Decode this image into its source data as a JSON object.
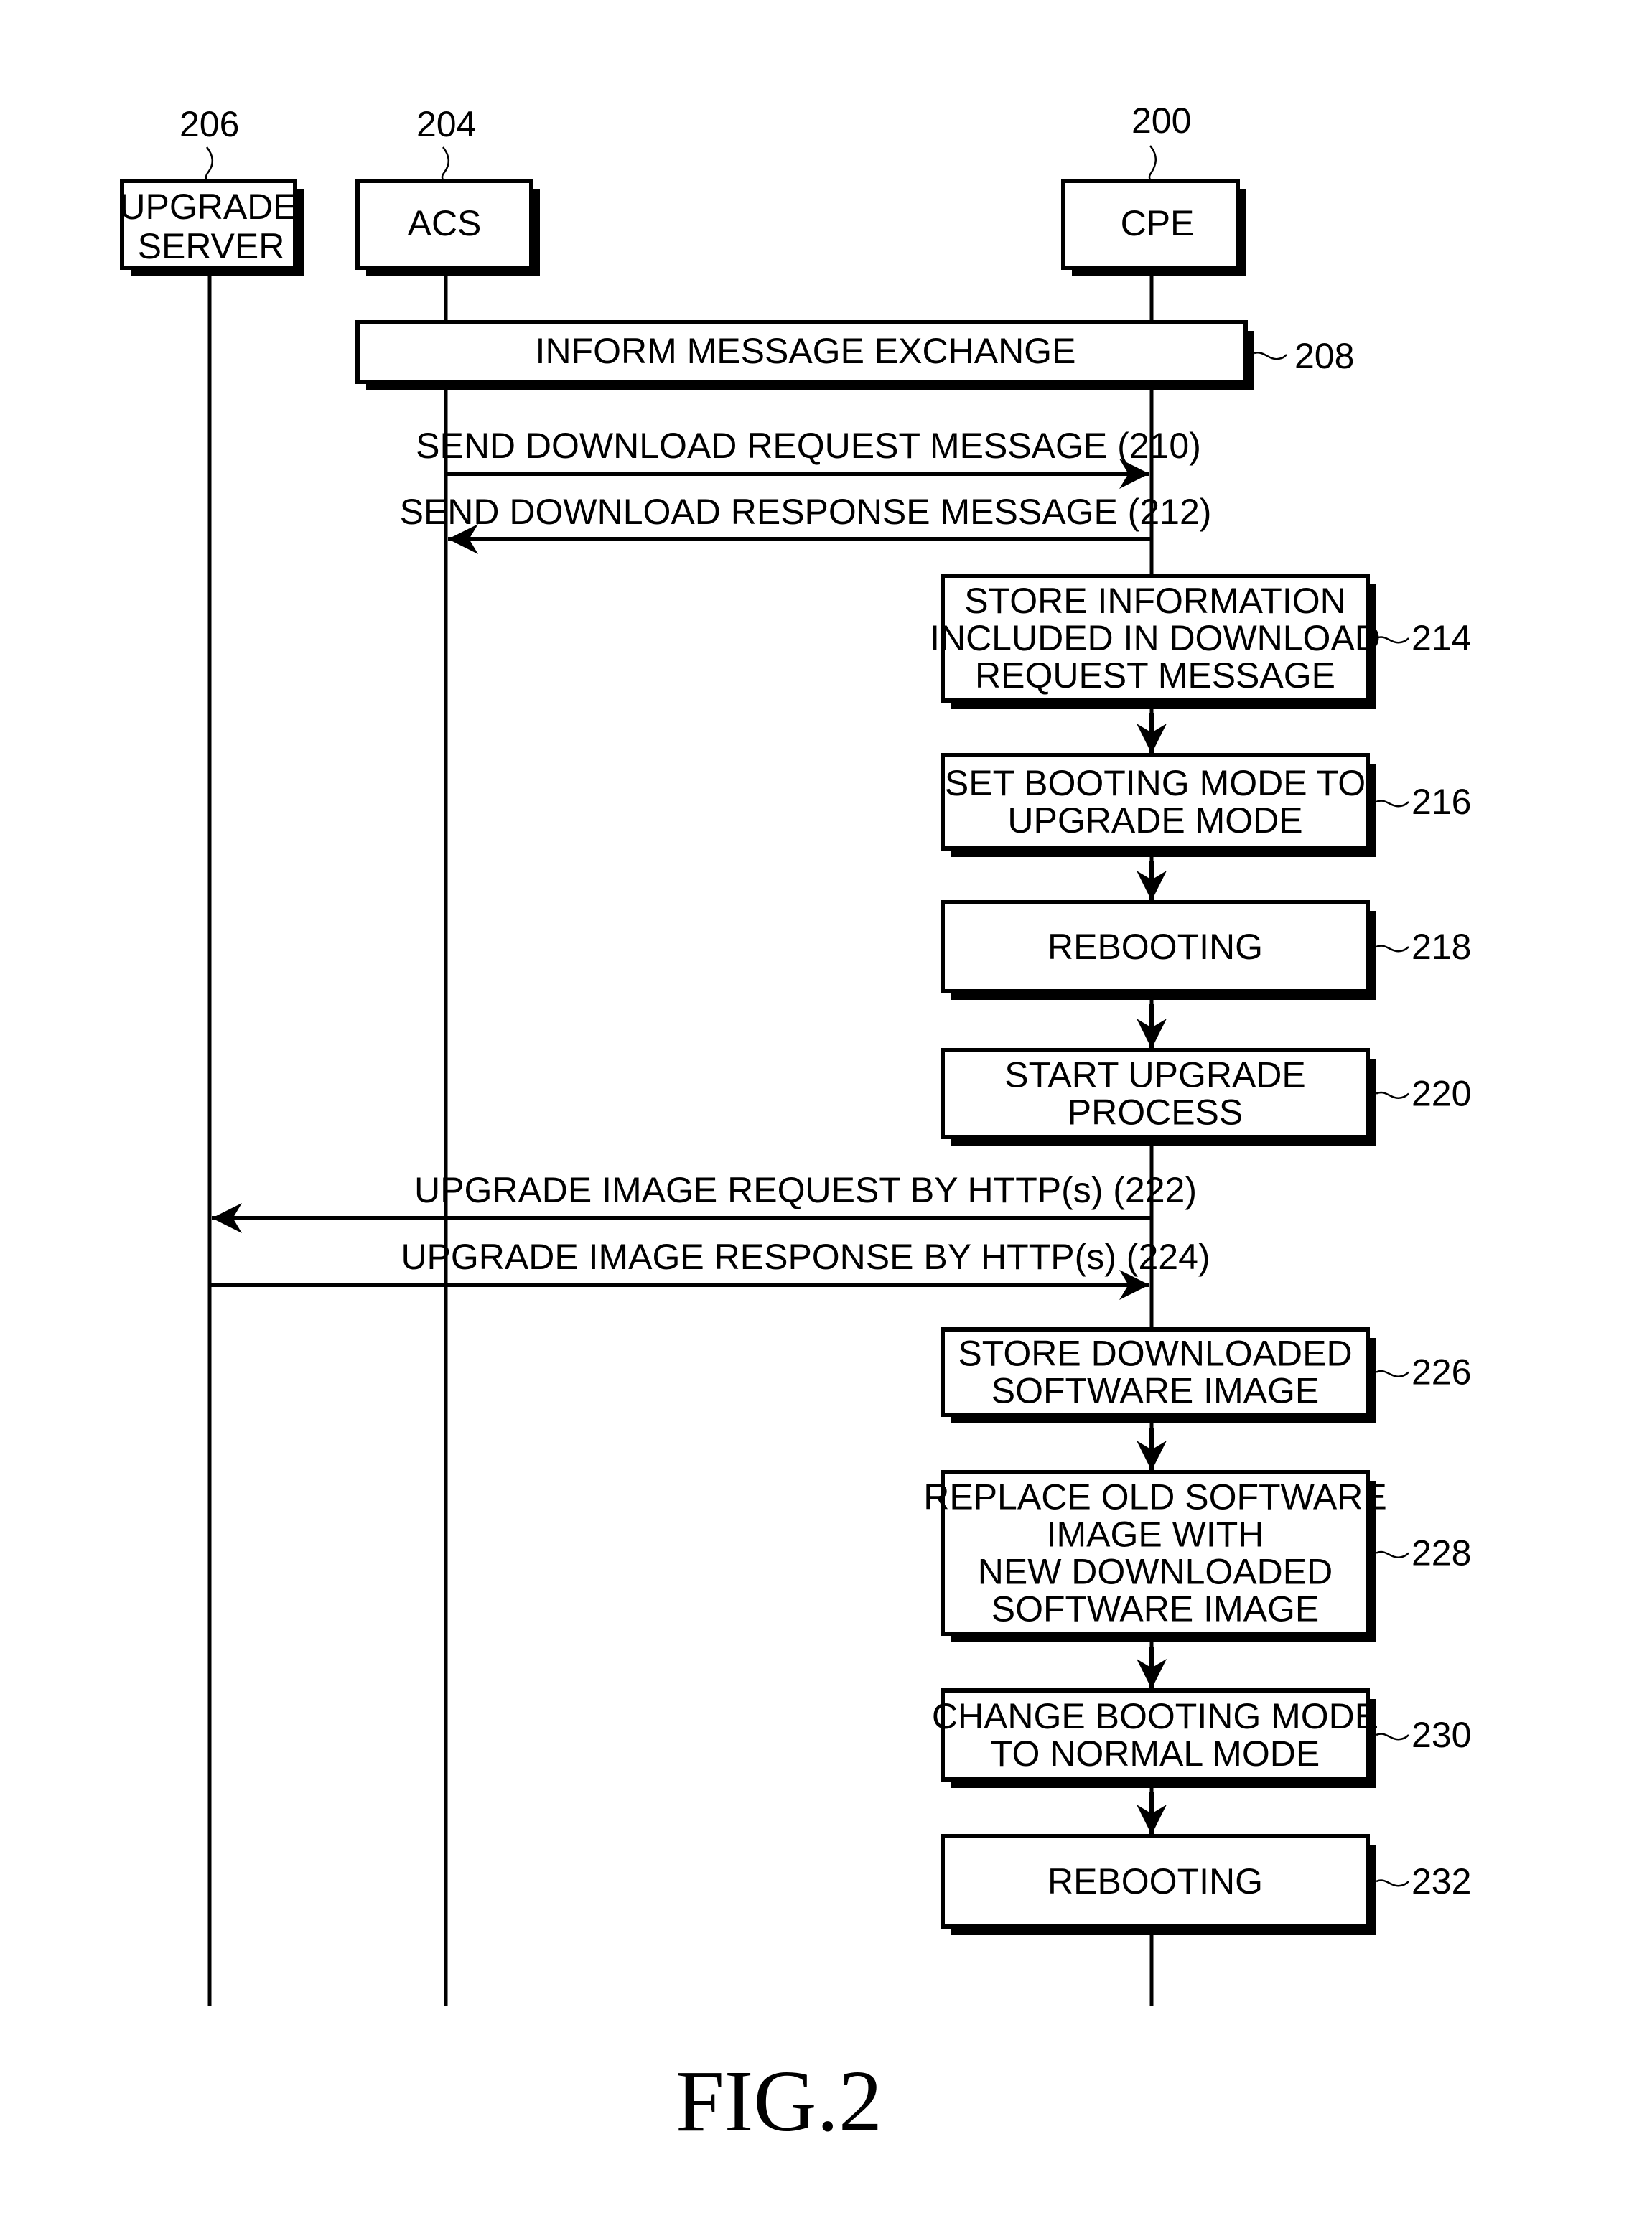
{
  "figure_label": "FIG.2",
  "entities": [
    {
      "ref": "206",
      "lines": [
        "UPGRADE",
        "SERVER"
      ]
    },
    {
      "ref": "204",
      "lines": [
        "ACS"
      ]
    },
    {
      "ref": "200",
      "lines": [
        "CPE"
      ]
    }
  ],
  "inform": {
    "label": "INFORM MESSAGE EXCHANGE",
    "ref": "208"
  },
  "messages": [
    {
      "label": "SEND DOWNLOAD REQUEST MESSAGE (210)",
      "from": "ACS",
      "to": "CPE"
    },
    {
      "label": "SEND DOWNLOAD RESPONSE MESSAGE (212)",
      "from": "CPE",
      "to": "ACS"
    },
    {
      "label": "UPGRADE IMAGE REQUEST BY HTTP(s) (222)",
      "from": "CPE",
      "to": "UPGRADE SERVER"
    },
    {
      "label": "UPGRADE IMAGE RESPONSE BY HTTP(s) (224)",
      "from": "UPGRADE SERVER",
      "to": "CPE"
    }
  ],
  "steps": [
    {
      "ref": "214",
      "lines": [
        "STORE INFORMATION",
        "INCLUDED IN DOWNLOAD",
        "REQUEST MESSAGE"
      ]
    },
    {
      "ref": "216",
      "lines": [
        "SET BOOTING MODE TO",
        "UPGRADE MODE"
      ]
    },
    {
      "ref": "218",
      "lines": [
        "REBOOTING"
      ]
    },
    {
      "ref": "220",
      "lines": [
        "START UPGRADE",
        "PROCESS"
      ]
    },
    {
      "ref": "226",
      "lines": [
        "STORE DOWNLOADED",
        "SOFTWARE IMAGE"
      ]
    },
    {
      "ref": "228",
      "lines": [
        "REPLACE OLD SOFTWARE",
        "IMAGE WITH",
        "NEW DOWNLOADED",
        "SOFTWARE IMAGE"
      ]
    },
    {
      "ref": "230",
      "lines": [
        "CHANGE BOOTING MODE",
        "TO NORMAL MODE"
      ]
    },
    {
      "ref": "232",
      "lines": [
        "REBOOTING"
      ]
    }
  ]
}
